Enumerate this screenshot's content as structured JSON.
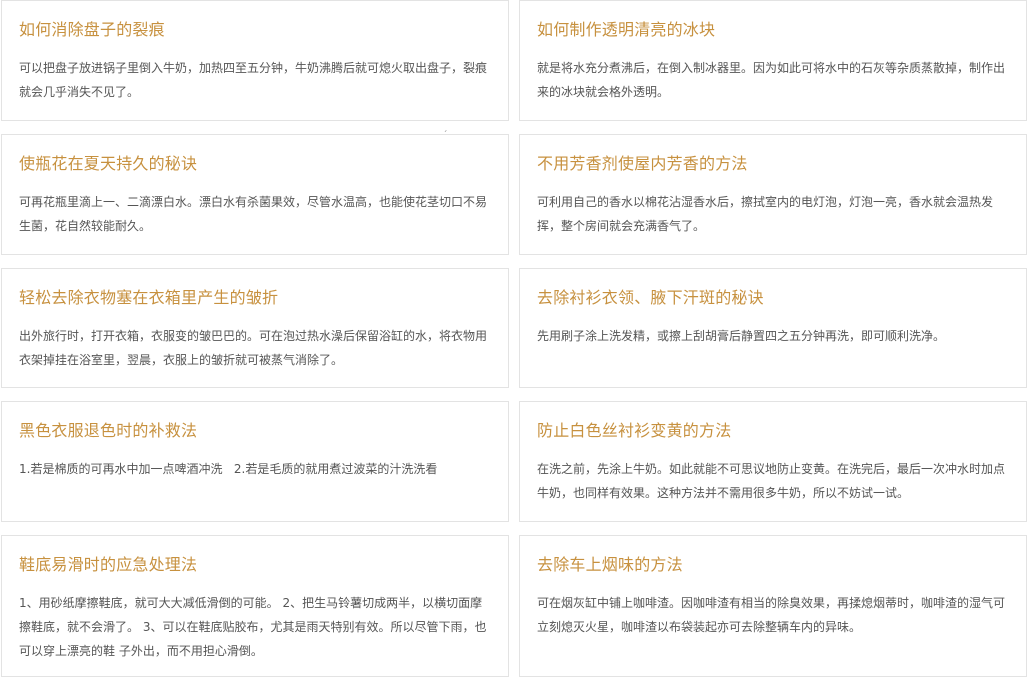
{
  "cards": [
    {
      "title": "如何消除盘子的裂痕",
      "desc": "可以把盘子放进锅子里倒入牛奶，加热四至五分钟，牛奶沸腾后就可熄火取出盘子，裂痕就会几乎消失不见了。"
    },
    {
      "title": "如何制作透明清亮的冰块",
      "desc": "就是将水充分煮沸后，在倒入制冰器里。因为如此可将水中的石灰等杂质蒸散掉，制作出来的冰块就会格外透明。"
    },
    {
      "title": "使瓶花在夏天持久的秘诀",
      "desc": "可再花瓶里滴上一、二滴漂白水。漂白水有杀菌果效，尽管水温高，也能使花茎切口不易生菌，花自然较能耐久。"
    },
    {
      "title": "不用芳香剂使屋内芳香的方法",
      "desc": "可利用自己的香水以棉花沾湿香水后，擦拭室内的电灯泡，灯泡一亮，香水就会温热发挥，整个房间就会充满香气了。"
    },
    {
      "title": "轻松去除衣物塞在衣箱里产生的皱折",
      "desc": "出外旅行时，打开衣箱，衣服变的皱巴巴的。可在泡过热水澡后保留浴缸的水，将衣物用衣架掉挂在浴室里，翌晨，衣服上的皱折就可被蒸气消除了。"
    },
    {
      "title": "去除衬衫衣领、腋下汗斑的秘诀",
      "desc": "先用刷子涂上洗发精，或擦上刮胡膏后静置四之五分钟再洗，即可顺利洗净。"
    },
    {
      "title": "黑色衣服退色时的补救法",
      "desc": "1.若是棉质的可再水中加一点啤酒冲洗   2.若是毛质的就用煮过波菜的汁洗洗看"
    },
    {
      "title": "防止白色丝衬衫变黄的方法",
      "desc": "在洗之前，先涂上牛奶。如此就能不可思议地防止变黄。在洗完后，最后一次冲水时加点牛奶，也同样有效果。这种方法并不需用很多牛奶，所以不妨试一试。"
    },
    {
      "title": "鞋底易滑时的应急处理法",
      "desc": "1、用砂纸摩擦鞋底，就可大大减低滑倒的可能。 2、把生马铃薯切成两半，以横切面摩擦鞋底，就不会滑了。 3、可以在鞋底贴胶布，尤其是雨天特别有效。所以尽管下雨，也可以穿上漂亮的鞋 子外出，而不用担心滑倒。"
    },
    {
      "title": "去除车上烟味的方法",
      "desc": "可在烟灰缸中铺上咖啡渣。因咖啡渣有相当的除臭效果，再揉熄烟蒂时，咖啡渣的湿气可立刻熄灭火星，咖啡渣以布袋装起亦可去除整辆车内的异味。"
    }
  ],
  "stray_mark": "ˏ"
}
